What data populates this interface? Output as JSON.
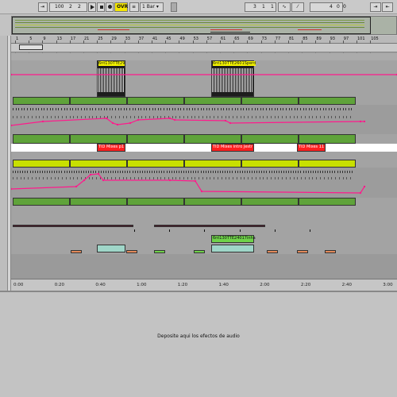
{
  "transport": {
    "tempo": "100",
    "sig_num": "2",
    "sig_den": "2",
    "ovr_label": "OVR",
    "quant_label": "1 Bar",
    "pos_bar": "3",
    "pos_beat": "1",
    "pos_sixteenth": "1",
    "loop_len_a": "4",
    "loop_len_b": "0",
    "loop_len_c": "0"
  },
  "ruler": {
    "bars": [
      "1",
      "5",
      "9",
      "13",
      "17",
      "21",
      "25",
      "29",
      "33",
      "37",
      "41",
      "45",
      "49",
      "53",
      "57",
      "61",
      "65",
      "69",
      "73",
      "77",
      "81",
      "85",
      "89",
      "93",
      "97",
      "101",
      "105"
    ]
  },
  "timeline": {
    "labels": [
      "0:00",
      "0:20",
      "0:40",
      "1:00",
      "1:20",
      "1:40",
      "2:00",
      "2:20",
      "2:40",
      "3:00"
    ]
  },
  "clips": {
    "audio_a": "6nt130TTE29",
    "audio_b": "6nt130TTE2601Sperd",
    "red_a": "TID Mixes p1",
    "red_b": "TID Mixes intro Jestr",
    "red_c": "TID Mixes 11",
    "green_c": "6nt130TTE24017inha"
  },
  "lower": {
    "drop_text": "Deposite aqui los efectos de audio"
  },
  "colors": {
    "automation": "#ff1a8c",
    "clip_green": "#5fa33a",
    "clip_yellow": "#c8e000",
    "clip_red": "#ff2020",
    "clip_audio_label": "#f8f800"
  }
}
